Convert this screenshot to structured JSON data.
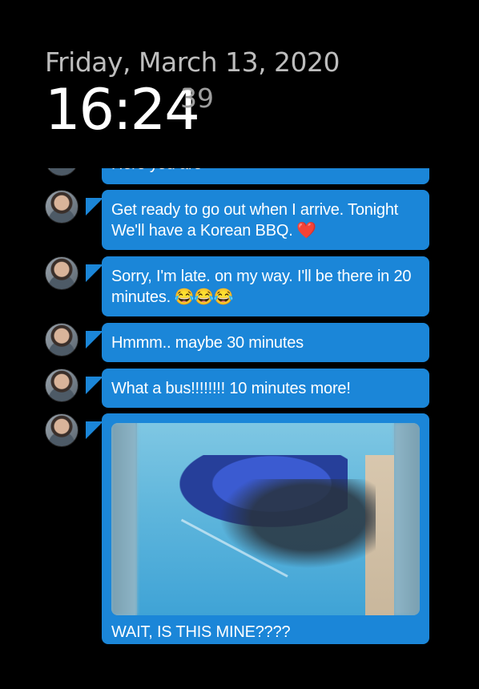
{
  "lockscreen": {
    "date": "Friday, March 13, 2020",
    "time": "16:24",
    "seconds": "39"
  },
  "thread": {
    "partial_top_text": "Here you are",
    "messages": [
      {
        "text": "Get ready to go out when I arrive. Tonight We'll have a Korean BBQ.",
        "emoji": "❤️"
      },
      {
        "text": "Sorry, I'm late. on my way. I'll be there in 20 minutes.",
        "emoji": "😂😂😂"
      },
      {
        "text": "Hmmm.. maybe 30 minutes",
        "emoji": ""
      },
      {
        "text": "What a bus!!!!!!!! 10 minutes more!",
        "emoji": ""
      },
      {
        "text": "WAIT, IS THIS MINE????",
        "emoji": ""
      }
    ]
  },
  "colors": {
    "bubble": "#1b86d8",
    "background": "#000000"
  }
}
